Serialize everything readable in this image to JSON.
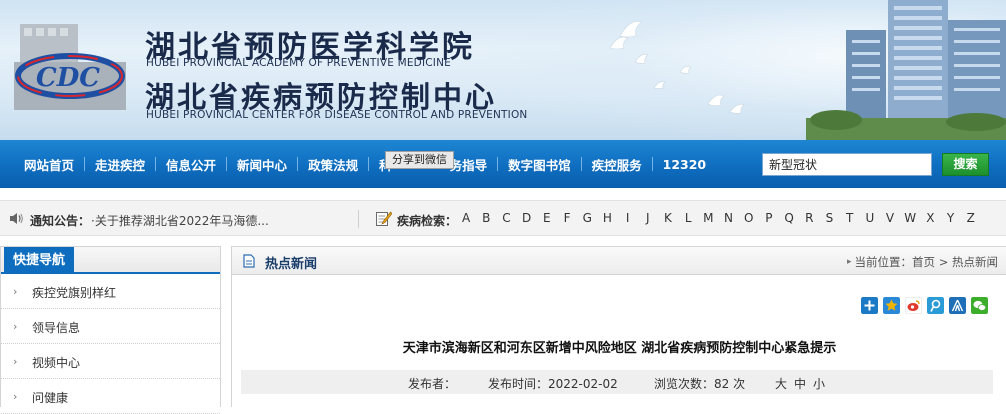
{
  "banner": {
    "title_cn_1": "湖北省预防医学科学院",
    "title_en_1": "HUBEI PROVINCIAL ACADEMY OF PREVENTIVE MEDICINE",
    "title_cn_2": "湖北省疾病预防控制中心",
    "title_en_2": "HUBEI PROVINCIAL CENTER FOR DISEASE CONTROL AND PREVENTION",
    "logo_icon": "cdc-logo-icon"
  },
  "nav": {
    "items": [
      {
        "label": "网站首页"
      },
      {
        "label": "走进疾控"
      },
      {
        "label": "信息公开"
      },
      {
        "label": "新闻中心"
      },
      {
        "label": "政策法规"
      },
      {
        "label": "科"
      },
      {
        "label": "务指导"
      },
      {
        "label": "数字图书馆"
      },
      {
        "label": "疾控服务"
      },
      {
        "label": "12320"
      }
    ],
    "tooltip": "分享到微信",
    "search_value": "新型冠状",
    "search_button": "搜索"
  },
  "notice": {
    "label": "通知公告：",
    "text": "·关于推荐湖北省2022年马海德...",
    "search_label": "疾病检索：",
    "letters": [
      "A",
      "B",
      "C",
      "D",
      "E",
      "F",
      "G",
      "H",
      "I",
      "J",
      "K",
      "L",
      "M",
      "N",
      "O",
      "P",
      "Q",
      "R",
      "S",
      "T",
      "U",
      "V",
      "W",
      "X",
      "Y",
      "Z"
    ]
  },
  "quicknav": {
    "title": "快捷导航",
    "items": [
      {
        "label": "疾控党旗别样红"
      },
      {
        "label": "领导信息"
      },
      {
        "label": "视频中心"
      },
      {
        "label": "问健康"
      }
    ]
  },
  "main": {
    "section_title": "热点新闻",
    "crumb_prefix": "当前位置：",
    "crumb_home": "首页",
    "crumb_sep": " > ",
    "crumb_current": "热点新闻",
    "share_icons": [
      {
        "name": "share-more-icon",
        "color": "#1a7ac6"
      },
      {
        "name": "qzone-icon",
        "color": "#f0b400"
      },
      {
        "name": "weibo-icon",
        "color": "#e03a2f"
      },
      {
        "name": "tencent-weibo-icon",
        "color": "#2b9bd8"
      },
      {
        "name": "renren-icon",
        "color": "#1e6fb8"
      },
      {
        "name": "wechat-icon",
        "color": "#3dae2b"
      }
    ],
    "article_title": "天津市滨海新区和河东区新增中风险地区 湖北省疾病预防控制中心紧急提示",
    "meta": {
      "publisher": "发布者：",
      "date": "发布时间：2022-02-02",
      "views": "浏览次数：82 次",
      "size_large": "大",
      "size_medium": "中",
      "size_small": "小"
    }
  }
}
